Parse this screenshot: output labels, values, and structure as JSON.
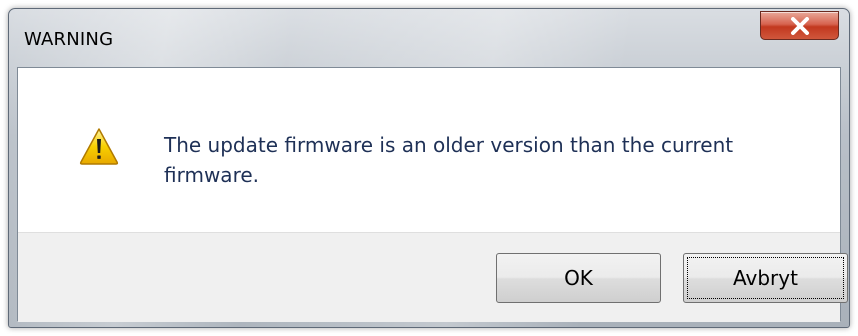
{
  "dialog": {
    "title": "WARNING",
    "message": "The update firmware is an older version than the current firmware.",
    "icon": "warning-icon",
    "buttons": {
      "ok_label": "OK",
      "cancel_label": "Avbryt",
      "focused": "cancel"
    }
  },
  "colors": {
    "close_button": "#c9452c",
    "message_text": "#1e3056",
    "button_bar": "#f0f0f0",
    "warning_yellow": "#f5c400"
  }
}
